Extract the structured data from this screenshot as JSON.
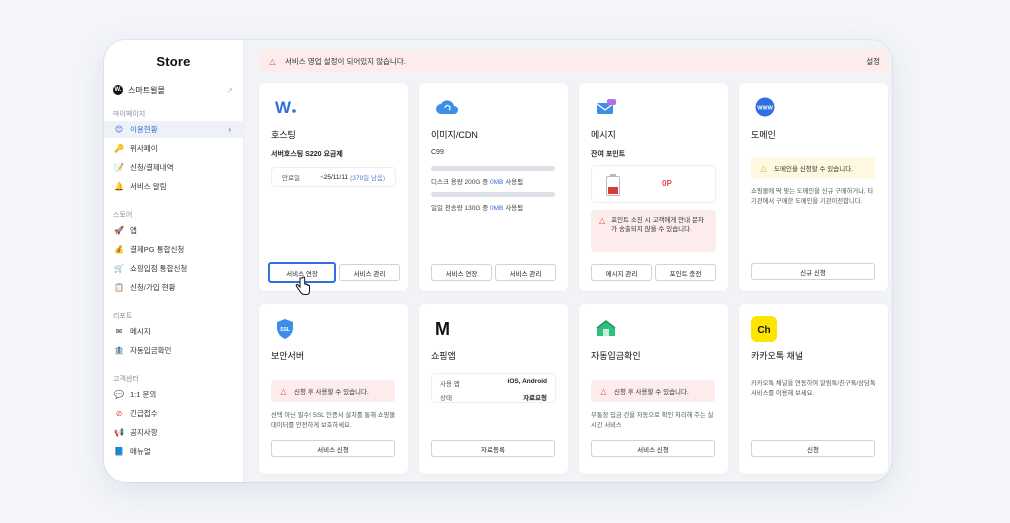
{
  "sidebar": {
    "brand": "Store",
    "store_name": "스마트윌몰",
    "store_logo_letter": "W.",
    "sections": [
      {
        "title": "마이페이지",
        "items": [
          {
            "label": "이용현황",
            "icon": "smile-icon",
            "active": true
          },
          {
            "label": "위사페이",
            "icon": "key-icon"
          },
          {
            "label": "신청/결제내역",
            "icon": "memo-icon"
          },
          {
            "label": "서비스 알림",
            "icon": "bell-icon"
          }
        ]
      },
      {
        "title": "스토어",
        "items": [
          {
            "label": "앱",
            "icon": "rocket-icon"
          },
          {
            "label": "결제PG 통합신청",
            "icon": "money-bag-icon"
          },
          {
            "label": "쇼핑입점 통합신청",
            "icon": "cart-icon"
          },
          {
            "label": "신청/가입 현황",
            "icon": "checklist-icon"
          }
        ]
      },
      {
        "title": "리포트",
        "items": [
          {
            "label": "메시지",
            "icon": "envelope-icon"
          },
          {
            "label": "자동입금확인",
            "icon": "bank-icon"
          }
        ]
      },
      {
        "title": "고객센터",
        "items": [
          {
            "label": "1:1 문의",
            "icon": "chat-icon"
          },
          {
            "label": "긴급접수",
            "icon": "prohibit-icon"
          },
          {
            "label": "공지사항",
            "icon": "megaphone-icon"
          },
          {
            "label": "매뉴얼",
            "icon": "book-icon"
          }
        ]
      }
    ]
  },
  "banner": {
    "text": "서비스 영업 설정이 되어있지 않습니다.",
    "settings_label": "설정"
  },
  "cards": {
    "hosting": {
      "title": "호스팅",
      "plan": "서버호스팅 S220 요금제",
      "expiry_label": "만료일",
      "expiry_value": "~25/11/11",
      "remaining": "(379일 남음)",
      "btn_extend": "서비스 연장",
      "btn_manage": "서비스 관리"
    },
    "cdn": {
      "title": "이미지/CDN",
      "plan": "C99",
      "disk_label_pre": "디스크 용량 200G 중 ",
      "disk_used": "0MB",
      "disk_label_post": " 사용됨",
      "traffic_label_pre": "일일 전송량 130G 중 ",
      "traffic_used": "0MB",
      "traffic_label_post": " 사용됨",
      "btn_extend": "서비스 연장",
      "btn_manage": "서비스 관리"
    },
    "message": {
      "title": "메시지",
      "sub": "잔여 포인트",
      "points": "0P",
      "warning": "포인트 소진 시 고객에게 안내 문자가 송출되지 않을 수 있습니다.",
      "btn_manage": "메시지 관리",
      "btn_charge": "포인트 충전"
    },
    "domain": {
      "title": "도메인",
      "notice": "도메인을 신청할 수 있습니다.",
      "desc": "쇼핑몰에 딱 맞는 도메인을 신규 구매하거나, 타 기관에서 구매한 도메인을 기관이전합니다.",
      "btn": "신규 신청",
      "logo_text": "WWW"
    },
    "ssl": {
      "title": "보안서버",
      "notice": "신청 후 사용할 수 있습니다.",
      "desc": "선택 아닌 필수! SSL 인증서 설치를 통해 쇼핑몰 데이터를 안전하게 보호하세요.",
      "btn": "서비스 신청",
      "logo_text": "SSL"
    },
    "shopping_app": {
      "title": "쇼핑앱",
      "row1_label": "사용 앱",
      "row1_value": "iOS, Android",
      "row2_label": "상태",
      "row2_value": "자료요청",
      "btn": "자료등록",
      "logo_text": "M"
    },
    "auto_deposit": {
      "title": "자동입금확인",
      "notice": "신청 후 사용할 수 있습니다.",
      "desc": "무통장 입금 건을 자동으로 확인 처리해 주는 실시간 서비스",
      "btn": "서비스 신청"
    },
    "kakao": {
      "title": "카카오톡 채널",
      "desc": "카카오톡 채널을 연동하여 알림톡/친구톡/상담톡 서비스를 이용해 보세요.",
      "btn": "신청",
      "logo_text": "Ch"
    }
  },
  "colors": {
    "accent": "#2f6fe0",
    "warning": "#e5484d",
    "banner_bg": "#fdecec",
    "notice_bg": "#fff8e0",
    "kakao": "#fee500"
  }
}
